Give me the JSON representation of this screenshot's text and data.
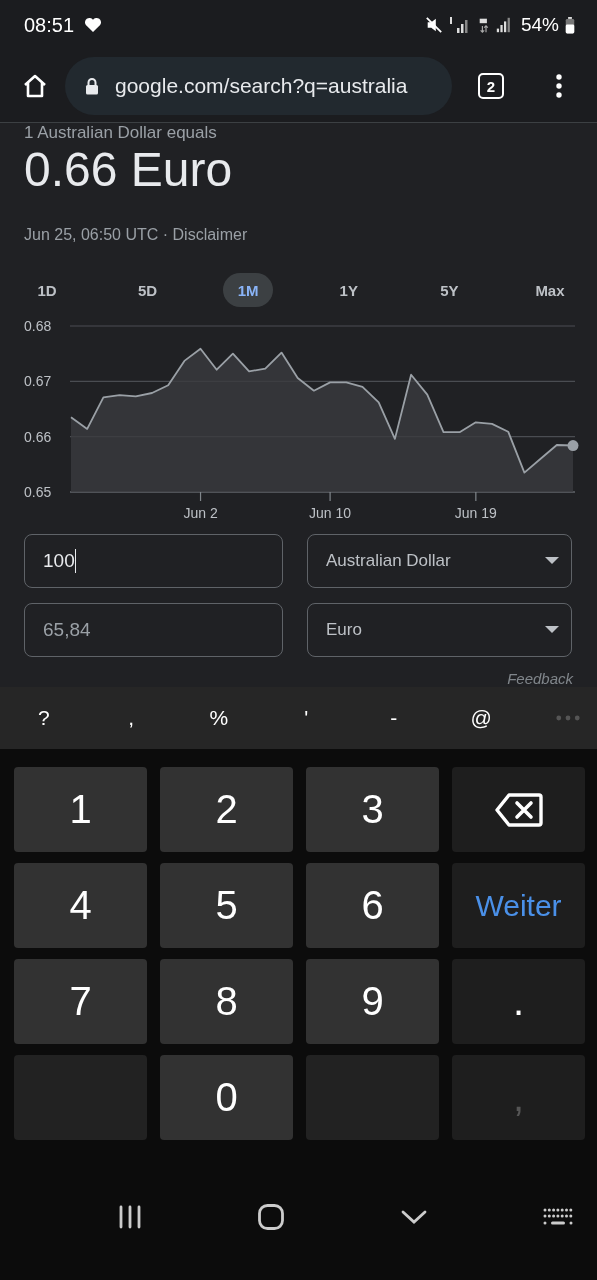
{
  "status_bar": {
    "time": "08:51",
    "battery": "54%"
  },
  "browser": {
    "url": "google.com/search?q=australia",
    "tab_count": "2"
  },
  "converter": {
    "caption": "1 Australian Dollar equals",
    "result": "0.66 Euro",
    "timestamp": "Jun 25, 06:50 UTC ·",
    "disclaimer": "Disclaimer",
    "ranges": [
      {
        "label": "1D",
        "selected": false
      },
      {
        "label": "5D",
        "selected": false
      },
      {
        "label": "1M",
        "selected": true
      },
      {
        "label": "1Y",
        "selected": false
      },
      {
        "label": "5Y",
        "selected": false
      },
      {
        "label": "Max",
        "selected": false
      }
    ],
    "chart_data": {
      "type": "area",
      "categories": [
        null,
        null,
        null,
        null,
        null,
        null,
        null,
        null,
        "Jun 2",
        null,
        null,
        null,
        null,
        null,
        null,
        null,
        "Jun 10",
        null,
        null,
        null,
        null,
        null,
        null,
        null,
        null,
        "Jun 19",
        null,
        null,
        null,
        null,
        null,
        null
      ],
      "series": [
        {
          "color": "#9aa0a6",
          "values": [
            0.6635,
            0.6614,
            0.6671,
            0.6675,
            0.6673,
            0.6679,
            0.6693,
            0.6737,
            0.6759,
            0.6721,
            0.675,
            0.6718,
            0.6723,
            0.6752,
            0.6706,
            0.6683,
            0.6698,
            0.6698,
            0.669,
            0.6662,
            0.6596,
            0.6712,
            0.6676,
            0.6608,
            0.6608,
            0.6626,
            0.6623,
            0.6609,
            0.6535,
            0.656,
            0.6585,
            0.6584
          ]
        }
      ],
      "ylim": [
        0.65,
        0.68
      ],
      "yticks": [
        {
          "value": 0.65,
          "label": "0.65"
        },
        {
          "value": 0.66,
          "label": "0.66"
        },
        {
          "value": 0.67,
          "label": "0.67"
        },
        {
          "value": 0.68,
          "label": "0.68"
        }
      ]
    },
    "amount": {
      "value": "100",
      "currency": "Australian Dollar"
    },
    "converted": {
      "value": "65,84",
      "currency": "Euro"
    },
    "feedback": "Feedback"
  },
  "keyboard": {
    "symbols": [
      "?",
      ",",
      "%",
      "'",
      "-",
      "@"
    ],
    "keys": [
      {
        "kind": "char",
        "label": "1"
      },
      {
        "kind": "char",
        "label": "2"
      },
      {
        "kind": "char",
        "label": "3"
      },
      {
        "kind": "backspace"
      },
      {
        "kind": "char",
        "label": "4"
      },
      {
        "kind": "char",
        "label": "5"
      },
      {
        "kind": "char",
        "label": "6"
      },
      {
        "kind": "action",
        "label": "Weiter"
      },
      {
        "kind": "char",
        "label": "7"
      },
      {
        "kind": "char",
        "label": "8"
      },
      {
        "kind": "char",
        "label": "9"
      },
      {
        "kind": "side",
        "label": "."
      },
      {
        "kind": "blank"
      },
      {
        "kind": "char",
        "label": "0"
      },
      {
        "kind": "blank"
      },
      {
        "kind": "dim",
        "label": ","
      }
    ]
  }
}
